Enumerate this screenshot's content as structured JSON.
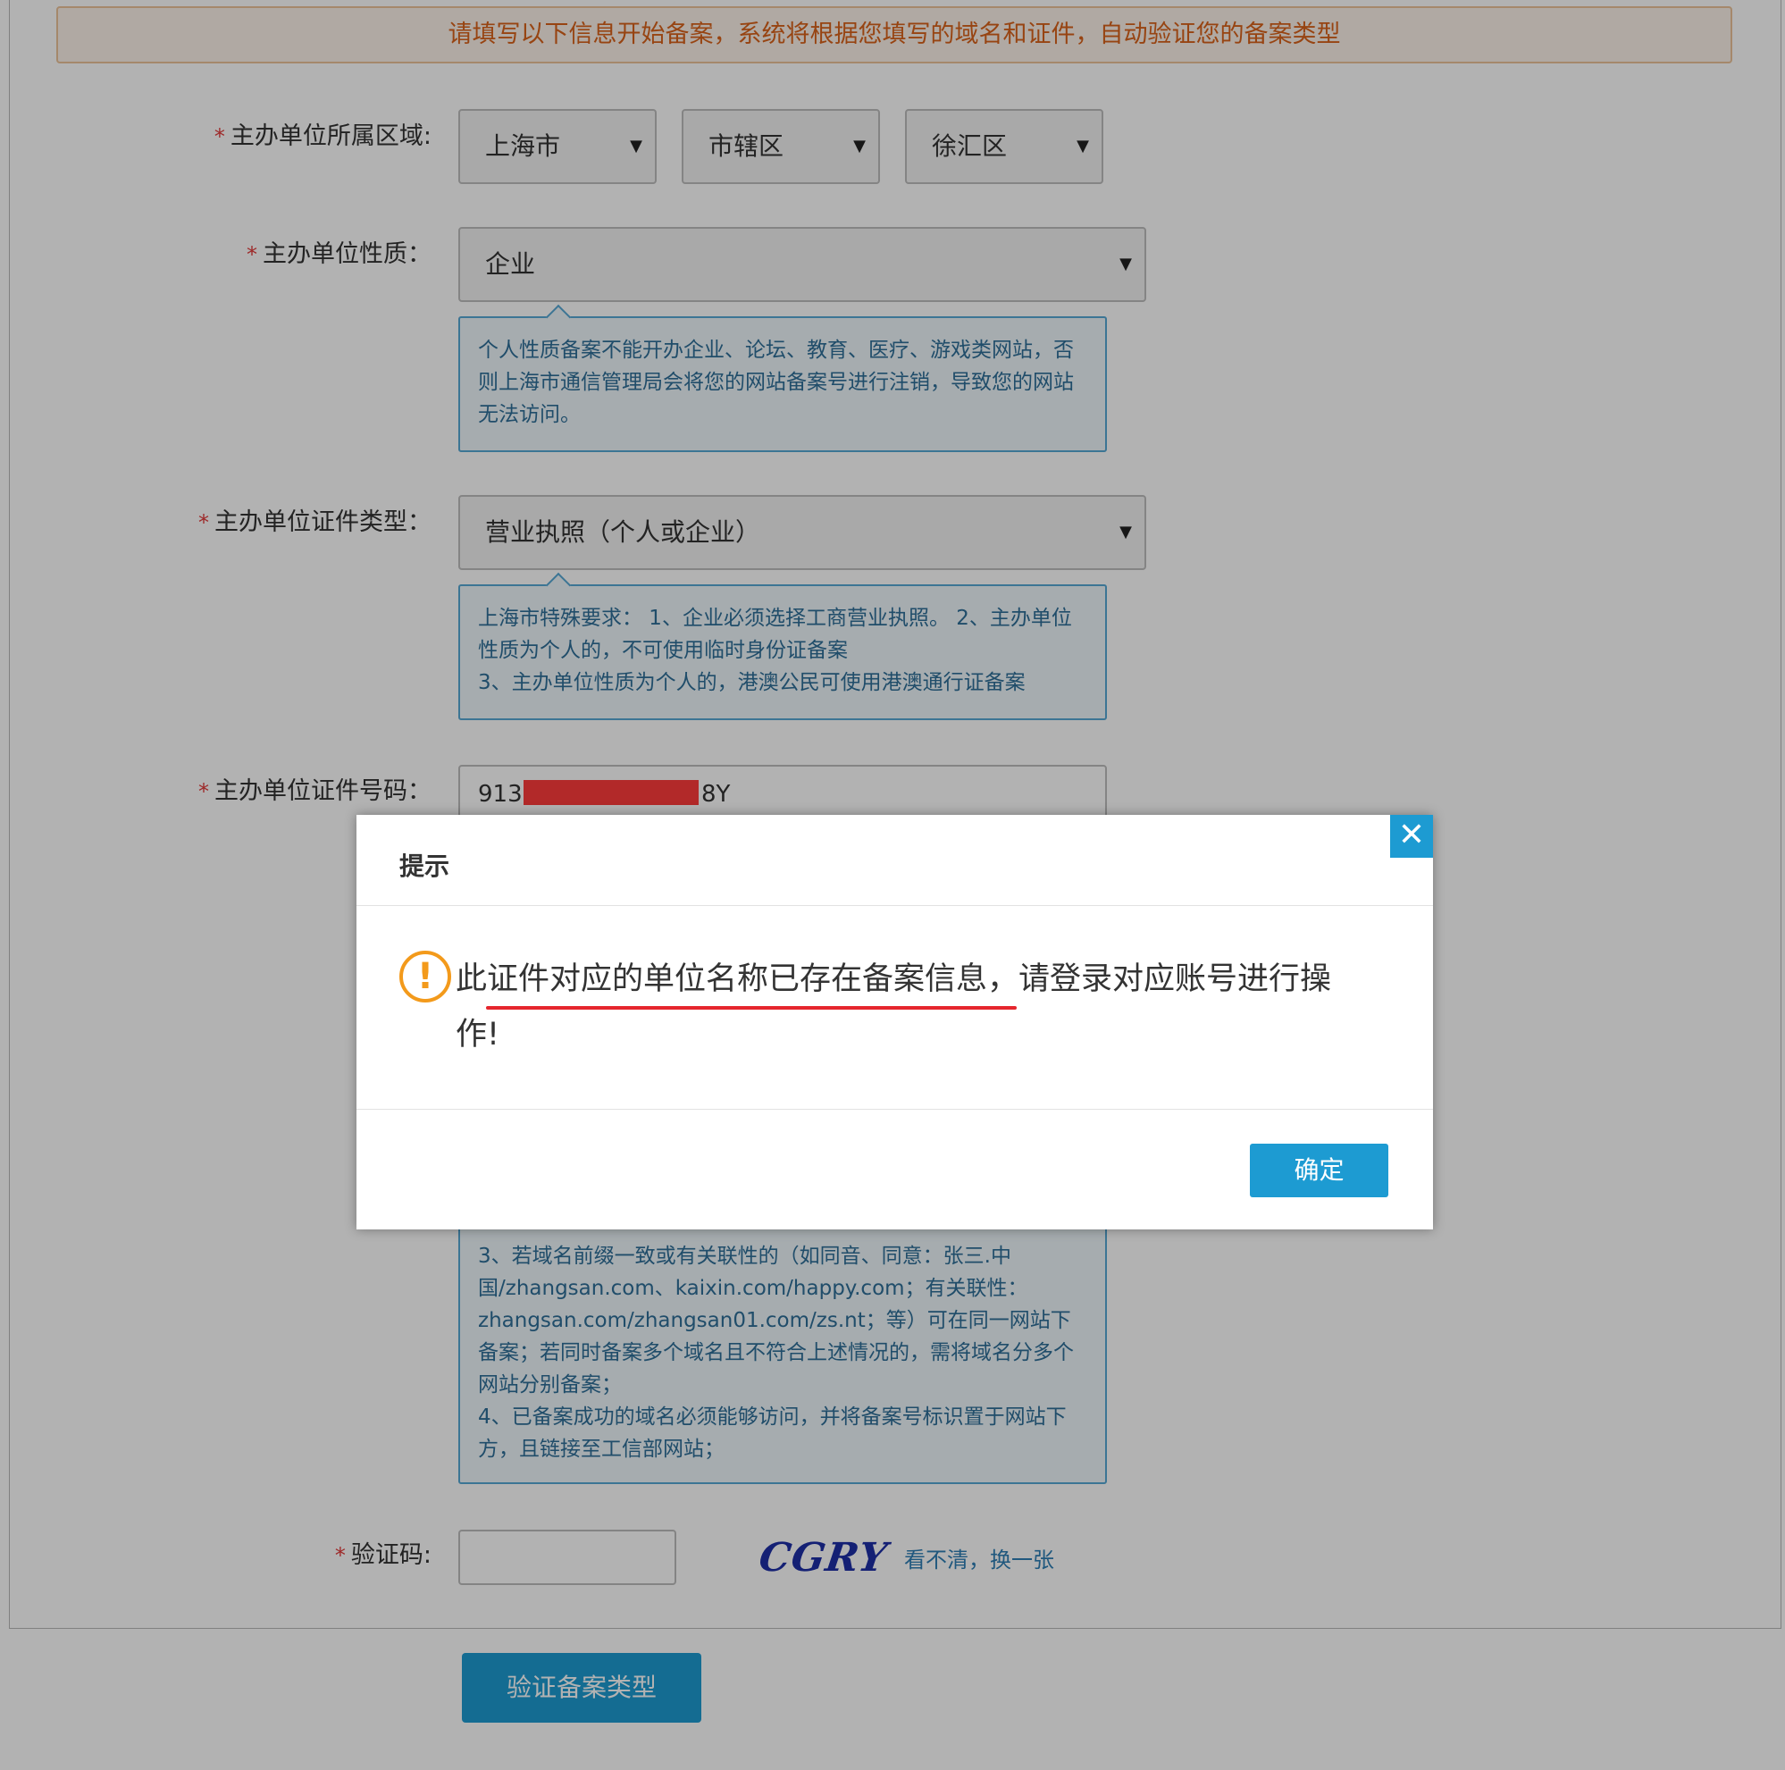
{
  "notice": "请填写以下信息开始备案，系统将根据您填写的域名和证件，自动验证您的备案类型",
  "form": {
    "region": {
      "label": "主办单位所属区域:",
      "province": "上海市",
      "city": "市辖区",
      "district": "徐汇区"
    },
    "nature": {
      "label": "主办单位性质：",
      "value": "企业",
      "hint": "个人性质备案不能开办企业、论坛、教育、医疗、游戏类网站，否则上海市通信管理局会将您的网站备案号进行注销，导致您的网站无法访问。"
    },
    "cert_type": {
      "label": "主办单位证件类型：",
      "value": "营业执照（个人或企业）",
      "hint_lines": [
        "上海市特殊要求： 1、企业必须选择工商营业执照。 2、主办单位性质为个人的，不可使用临时身份证备案",
        "3、主办单位性质为个人的，港澳公民可使用港澳通行证备案"
      ]
    },
    "cert_number": {
      "label": "主办单位证件号码：",
      "value_prefix": "913",
      "value_suffix": "8Y"
    },
    "domain_hint_lines": [
      "3、若域名前缀一致或有关联性的（如同音、同意：张三.中国/zhangsan.com、kaixin.com/happy.com；有关联性：zhangsan.com/zhangsan01.com/zs.nt；等）可在同一网站下备案；若同时备案多个域名且不符合上述情况的，需将域名分多个网站分别备案；",
      "4、已备案成功的域名必须能够访问，并将备案号标识置于网站下方，且链接至工信部网站；"
    ],
    "captcha": {
      "label": "验证码:",
      "value": "",
      "image_text": "CGRY",
      "refresh": "看不清，换一张"
    },
    "submit": "验证备案类型"
  },
  "dialog": {
    "title": "提示",
    "close": "✕",
    "icon": "warning-icon",
    "message": "此证件对应的单位名称已存在备案信息，请登录对应账号进行操作!",
    "ok": "确定"
  },
  "colors": {
    "accent": "#1d9bd2",
    "notice_text": "#d9621a",
    "warning": "#f39a1b",
    "required": "#e23b3b"
  }
}
